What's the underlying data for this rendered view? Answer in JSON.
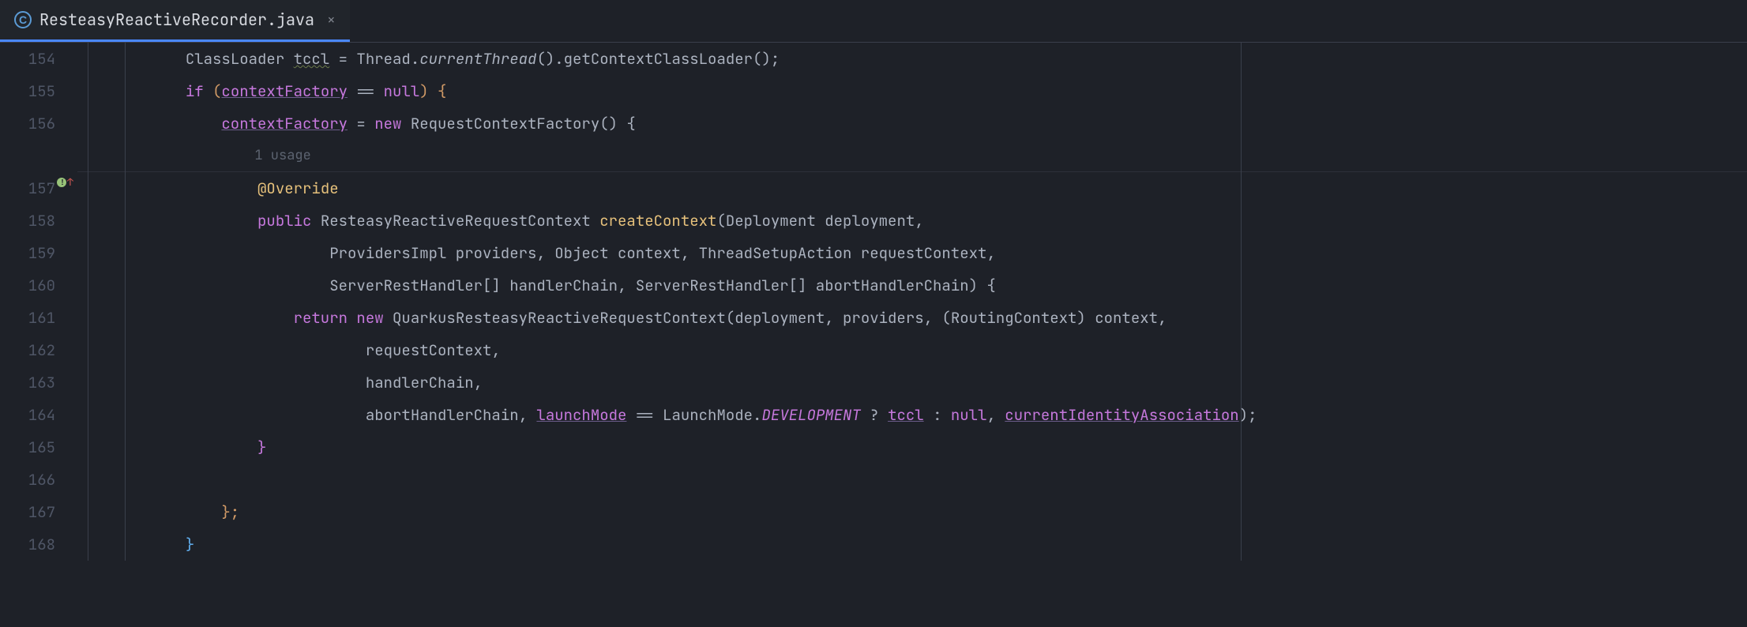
{
  "tab": {
    "title": "ResteasyReactiveRecorder.java",
    "icon_letter": "C",
    "close_glyph": "×"
  },
  "gutter": {
    "start": 154,
    "end": 168,
    "hint_after": 156,
    "marker_line": 158
  },
  "hint": "1 usage",
  "code": {
    "l154": {
      "pre": "            ",
      "a": "ClassLoader ",
      "tccl": "tccl",
      "b": " = Thread.",
      "ct": "currentThread",
      "c": "().getContextClassLoader();"
    },
    "l155": {
      "pre": "            ",
      "if": "if ",
      "lp": "(",
      "cf": "contextFactory",
      "op": " == ",
      "null": "null",
      "rp": ") {"
    },
    "l156": {
      "pre": "                ",
      "cf": "contextFactory",
      "eq": " = ",
      "new": "new ",
      "rcf": "RequestContextFactory() {"
    },
    "l157": {
      "pre": "                    ",
      "anno": "@Override"
    },
    "l158": {
      "pre": "                    ",
      "public": "public ",
      "ret": "ResteasyReactiveRequestContext ",
      "name": "createContext",
      "sig": "(Deployment deployment,"
    },
    "l159": {
      "pre": "                            ",
      "sig": "ProvidersImpl providers, Object context, ThreadSetupAction requestContext,"
    },
    "l160": {
      "pre": "                            ",
      "sig": "ServerRestHandler[] handlerChain, ServerRestHandler[] abortHandlerChain) {"
    },
    "l161": {
      "pre": "                        ",
      "return": "return ",
      "new": "new ",
      "ctor": "QuarkusResteasyReactiveRequestContext(deployment, providers, (RoutingContext) context,"
    },
    "l162": {
      "pre": "                                ",
      "txt": "requestContext,"
    },
    "l163": {
      "pre": "                                ",
      "txt": "handlerChain,"
    },
    "l164": {
      "pre": "                                ",
      "a": "abortHandlerChain, ",
      "lm": "launchMode",
      "b": " == LaunchMode.",
      "dev": "DEVELOPMENT",
      "c": " ? ",
      "tccl": "tccl",
      "d": " : ",
      "null": "null",
      "e": ", ",
      "cia": "currentIdentityAssociation",
      "f": ");"
    },
    "l165": {
      "pre": "                    ",
      "brace": "}"
    },
    "l166": {
      "pre": ""
    },
    "l167": {
      "pre": "                ",
      "brace": "};"
    },
    "l168": {
      "pre": "            ",
      "brace": "}"
    }
  }
}
